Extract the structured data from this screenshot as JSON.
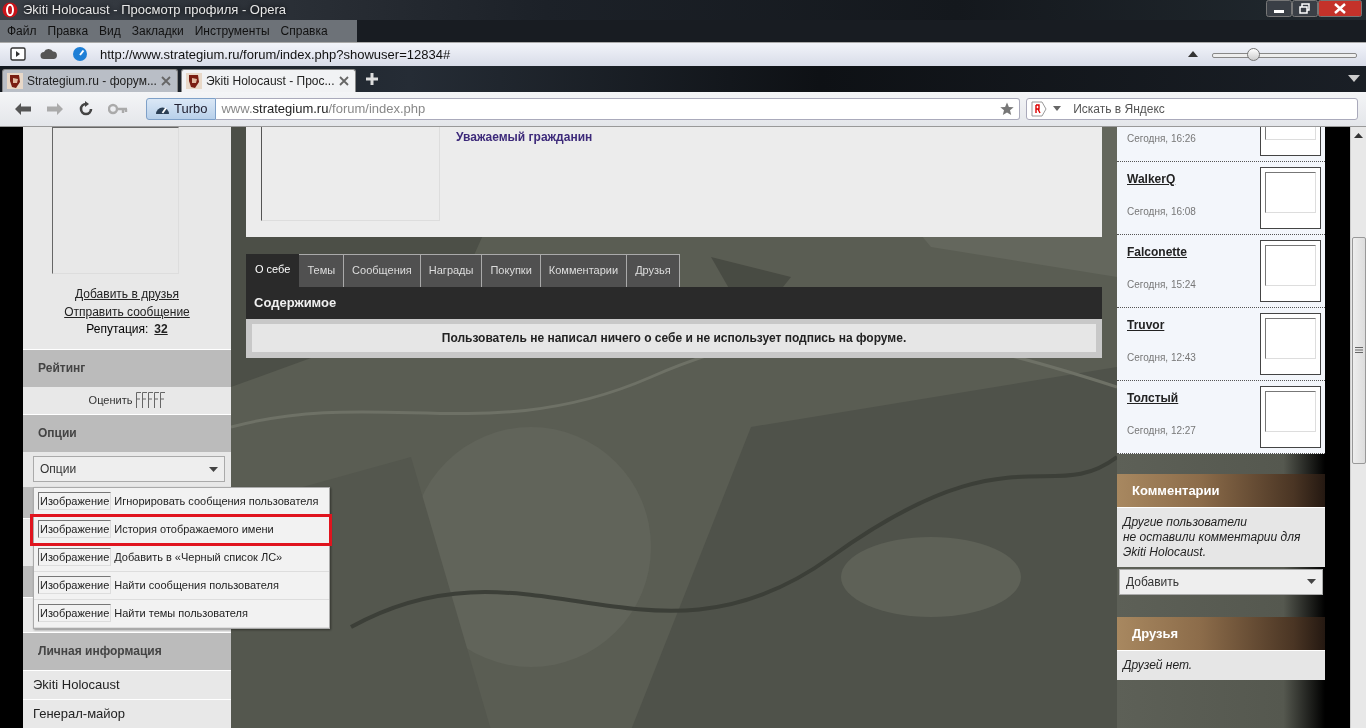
{
  "window": {
    "title": "Эkiti Holocaust - Просмотр профиля - Opera"
  },
  "menu_bar": [
    "Файл",
    "Правка",
    "Вид",
    "Закладки",
    "Инструменты",
    "Справка"
  ],
  "status_url": "http://www.strategium.ru/forum/index.php?showuser=12834#",
  "zoom_slider": {
    "level": 0.28
  },
  "tabs": [
    {
      "label": "Strategium.ru - форум...",
      "selected": false
    },
    {
      "label": "Эkiti Holocaust - Прос...",
      "selected": true
    }
  ],
  "toolbar": {
    "turbo": "Turbo",
    "address_parts": [
      {
        "text": "www.",
        "emphasis": false
      },
      {
        "text": "strategium.ru",
        "emphasis": true
      },
      {
        "text": "/forum/index.php",
        "emphasis": false
      }
    ],
    "search": {
      "placeholder": "Искать в Яндекс"
    }
  },
  "sidebar": {
    "links": [
      "Добавить в друзья",
      "Отправить сообщение"
    ],
    "reputation": {
      "label": "Репутация:",
      "value": "32"
    },
    "rating": {
      "header": "Рейтинг",
      "label": "Оценить"
    },
    "options": {
      "header": "Опции",
      "select": "Опции"
    },
    "personal": {
      "header": "Личная информация",
      "rows": [
        "Эkiti Holocaust",
        "Генерал-майор"
      ]
    }
  },
  "options_menu": [
    {
      "icon_alt": "Изображение",
      "label": "Игнорировать сообщения пользователя",
      "highlighted": false
    },
    {
      "icon_alt": "Изображение",
      "label": "История отображаемого имени",
      "highlighted": true
    },
    {
      "icon_alt": "Изображение",
      "label": "Добавить в «Черный список ЛС»",
      "highlighted": false
    },
    {
      "icon_alt": "Изображение",
      "label": "Найти сообщения пользователя",
      "highlighted": false
    },
    {
      "icon_alt": "Изображение",
      "label": "Найти темы пользователя",
      "highlighted": false
    }
  ],
  "profile": {
    "rank_title": "Уважаемый гражданин"
  },
  "profile_tabs": [
    {
      "label": "О себе",
      "selected": true
    },
    {
      "label": "Темы",
      "selected": false
    },
    {
      "label": "Сообщения",
      "selected": false
    },
    {
      "label": "Награды",
      "selected": false
    },
    {
      "label": "Покупки",
      "selected": false
    },
    {
      "label": "Комментарии",
      "selected": false
    },
    {
      "label": "Друзья",
      "selected": false
    }
  ],
  "content": {
    "header": "Содержимое",
    "message": "Пользователь не написал ничего о себе и не использует подпись на форуме."
  },
  "visitors": [
    {
      "time": "Сегодня, 16:26"
    },
    {
      "name": "WalkerQ",
      "time": "Сегодня, 16:08"
    },
    {
      "name": "Falconette",
      "time": "Сегодня, 15:24"
    },
    {
      "name": "Truvor",
      "time": "Сегодня, 12:43"
    },
    {
      "name": "Толстый",
      "time": "Сегодня, 12:27"
    }
  ],
  "comments": {
    "header": "Комментарии",
    "text": "Другие пользователи\nне оставили комментарии для\nЭkiti Holocaust.",
    "select": "Добавить"
  },
  "friends": {
    "header": "Друзья",
    "text": "Друзей нет."
  }
}
